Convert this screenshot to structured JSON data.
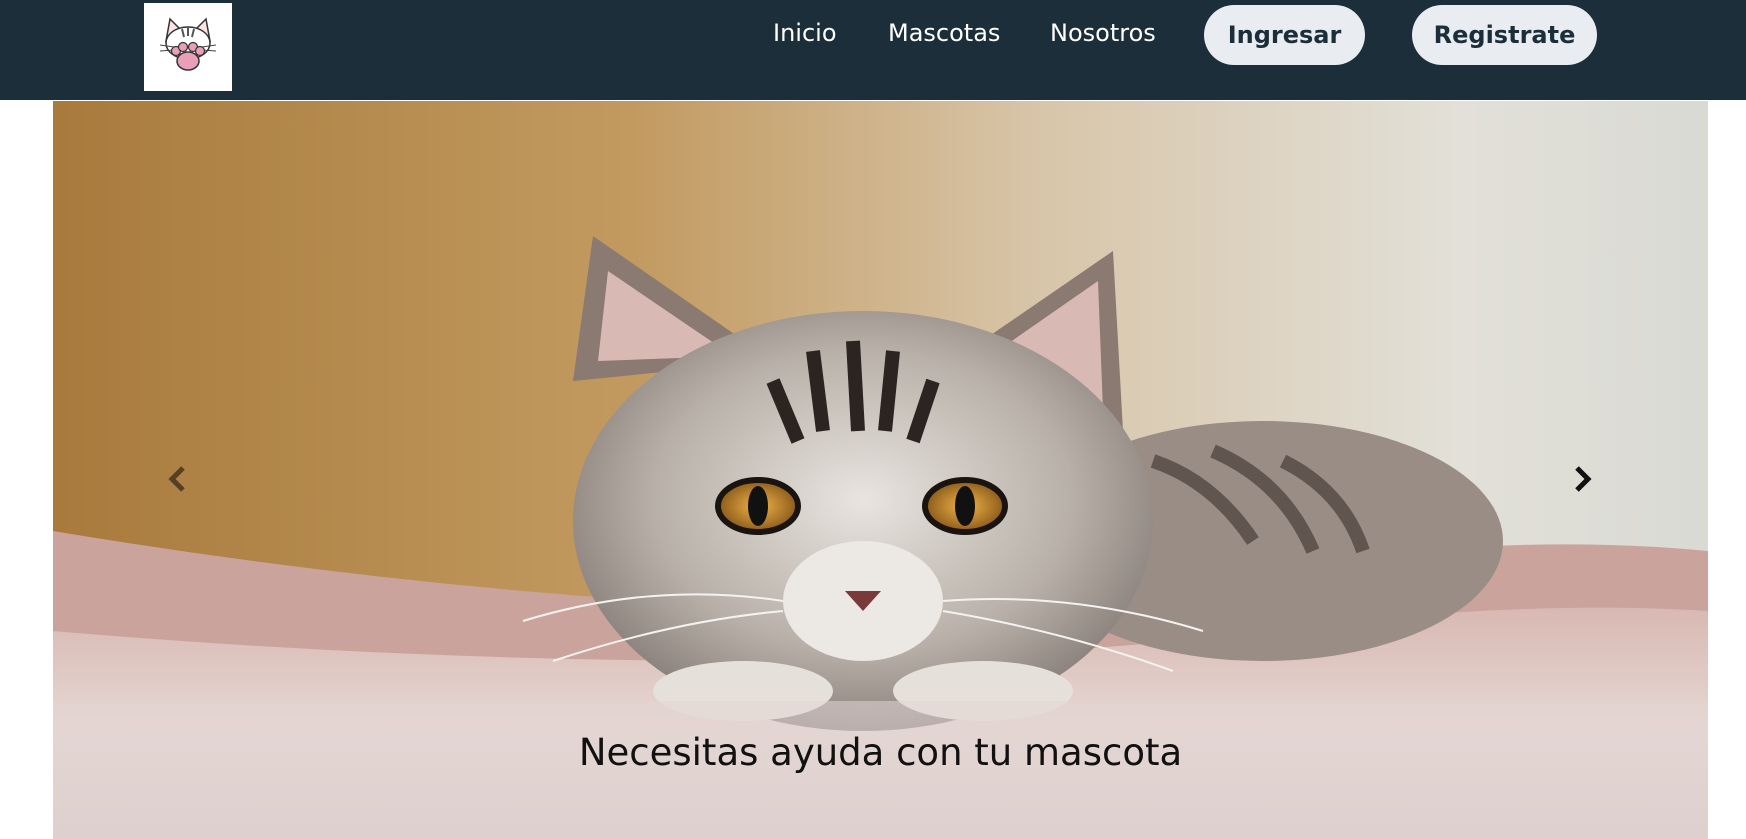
{
  "navbar": {
    "logo_icon": "cat-paw-logo-icon",
    "links": [
      {
        "label": "Inicio"
      },
      {
        "label": "Mascotas"
      },
      {
        "label": "Nosotros"
      }
    ],
    "login_label": "Ingresar",
    "register_label": "Registrate",
    "colors": {
      "background": "#1b2e3a",
      "button_bg": "#e9ecf1",
      "button_text": "#1b2e3a"
    }
  },
  "carousel": {
    "caption": "Necesitas ayuda con tu mascota",
    "prev_icon": "chevron-left-icon",
    "next_icon": "chevron-right-icon",
    "image_icon": "cat-photo-image"
  }
}
